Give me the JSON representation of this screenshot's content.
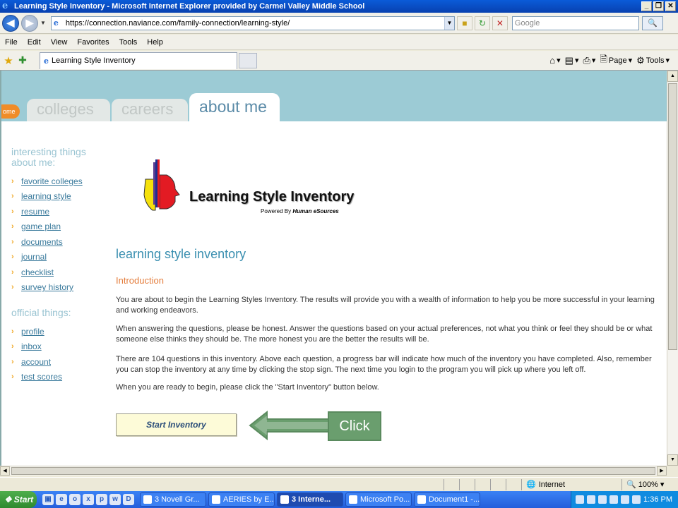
{
  "window": {
    "title": "Learning Style Inventory - Microsoft Internet Explorer provided by Carmel Valley Middle School",
    "min": "_",
    "max": "❐",
    "close": "✕"
  },
  "address": {
    "url": "https://connection.naviance.com/family-connection/learning-style/",
    "search_placeholder": "Google"
  },
  "menu": [
    "File",
    "Edit",
    "View",
    "Favorites",
    "Tools",
    "Help"
  ],
  "tab": {
    "label": "Learning Style Inventory"
  },
  "toolbar": {
    "page_label": "Page",
    "tools_label": "Tools"
  },
  "site": {
    "home_label": "ome",
    "tabs": {
      "colleges": "colleges",
      "careers": "careers",
      "about": "about me"
    }
  },
  "sidebar": {
    "heading1": "interesting things about me:",
    "group1": [
      "favorite colleges",
      "learning style",
      "resume",
      "game plan",
      "documents",
      "journal",
      "checklist",
      "survey history"
    ],
    "heading2": "official things:",
    "group2": [
      "profile",
      "inbox",
      "account",
      "test scores"
    ]
  },
  "content": {
    "logo_title": "Learning Style Inventory",
    "powered_prefix": "Powered By",
    "powered_brand": "Human eSources",
    "page_title": "learning style inventory",
    "section_title": "Introduction",
    "p1": "You are about to begin the Learning Styles Inventory. The results will provide you with a wealth of information to help you be more successful in your learning and working endeavors.",
    "p2": "When answering the questions, please be honest. Answer the questions based on your actual preferences, not what you think or feel they should be or what someone else thinks they should be. The more honest you are the better the results will be.",
    "p3": "There are 104 questions in this inventory. Above each question, a progress bar will indicate how much of the inventory you have completed. Also, remember you can stop the inventory at any time by clicking the stop sign. The next time you login to the program you will pick up where you left off.",
    "p4": "When you are ready to begin, please click the \"Start Inventory\" button below.",
    "start_button": "Start Inventory",
    "callout": "Click"
  },
  "status": {
    "zone": "Internet",
    "zoom": "100%"
  },
  "taskbar": {
    "start": "Start",
    "buttons": [
      "3 Novell Gr...",
      "AERIES by E...",
      "3 Interne...",
      "Microsoft Po...",
      "Document1 -..."
    ],
    "time": "1:36 PM"
  },
  "colors": {
    "accent_blue": "#3a8fb0",
    "intro_orange": "#e47d3c",
    "header_band": "#9ccbd5",
    "callout_green": "#6a9e6e"
  }
}
